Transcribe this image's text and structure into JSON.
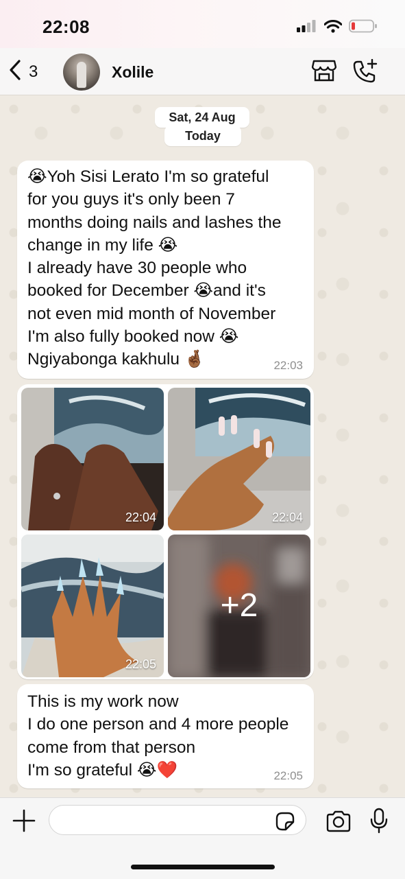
{
  "status_bar": {
    "time": "22:08"
  },
  "header": {
    "back_count": "3",
    "contact_name": "Xolile"
  },
  "chat": {
    "date_label": "Sat, 24 Aug",
    "today_label": "Today",
    "messages": [
      {
        "lines": [
          "😭Yoh Sisi Lerato I'm so grateful",
          "for you guys it's only been 7",
          "months doing nails and lashes the",
          "change in my life 😭",
          "I already have 30 people who",
          "booked for December 😭and it's",
          "not even mid month of November",
          "I'm also fully booked now 😭",
          "Ngiyabonga kakhulu 🤞🏾"
        ],
        "time": "22:03"
      },
      {
        "lines": [
          "This is my work now",
          "I do one person and 4 more people",
          "come from that person",
          "I'm so grateful 😭❤️"
        ],
        "time": "22:05"
      }
    ],
    "album": {
      "photos": [
        {
          "time": "22:04"
        },
        {
          "time": "22:04"
        },
        {
          "time": "22:05"
        }
      ],
      "more_count": "+2"
    }
  },
  "input": {
    "placeholder": ""
  },
  "colors": {
    "chat_bg": "#efeae2",
    "bubble": "#ffffff",
    "timestamp": "#8e8e8e"
  }
}
